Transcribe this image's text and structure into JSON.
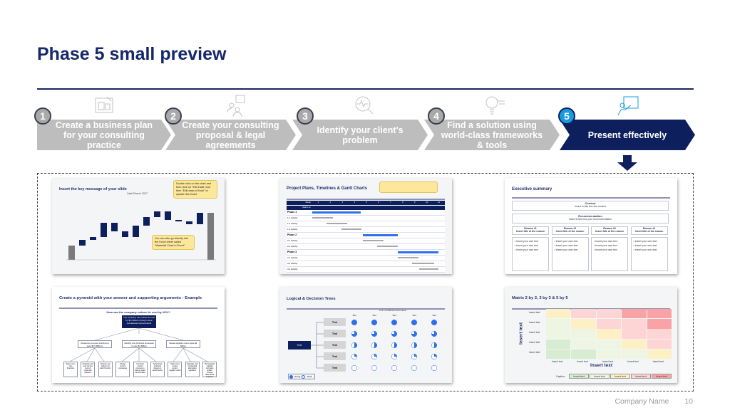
{
  "title": "Phase 5 small preview",
  "steps": [
    {
      "num": "1",
      "label": "Create a business plan for your consulting practice",
      "icon": "blueprint-icon"
    },
    {
      "num": "2",
      "label": "Create your consulting proposal & legal agreements",
      "icon": "people-question-icon"
    },
    {
      "num": "3",
      "label": "Identify your client's problem",
      "icon": "magnifier-pulse-icon"
    },
    {
      "num": "4",
      "label": "Find a solution using world-class frameworks & tools",
      "icon": "lightbulb-icon"
    },
    {
      "num": "5",
      "label": "Present effectively",
      "icon": "presenter-board-icon",
      "active": true
    }
  ],
  "colors": {
    "navy": "#0d1f5c",
    "accent": "#1a9be0",
    "inactive": "#bdbdbd",
    "gantt_phase": "#2f6fec",
    "bar": "#0d1f5c"
  },
  "previews": {
    "waterfall": {
      "title": "Insert the key message of your slide",
      "chart_title": "Cash Flow in 2017",
      "callout1": "Double click on the chart and then click on \"Edit Data\" and then \"Edit data in Excel\" to update this Chart",
      "callout2": "You can also go directly into the Excel sheet called \"Waterfall Chart in Excel\""
    },
    "gantt": {
      "title": "Project Plans, Timelines & Gantt Charts",
      "week_label": "Week",
      "starts_label": "Starts on",
      "weeks": [
        "1",
        "2",
        "3",
        "4",
        "5",
        "6",
        "7",
        "8",
        "9",
        "10",
        "11"
      ],
      "rows": [
        "Phase 1",
        "1.1 Activity",
        "1.2 Activity",
        "1.3 Activity",
        "Phase 2",
        "2.1 Activity",
        "2.2 Activity",
        "Phase 3",
        "3.1 Activity",
        "3.2 Activity",
        "3.3 Activity"
      ]
    },
    "exec": {
      "title": "Executive summary",
      "context": "Context",
      "context_text": "Insert in this box the context",
      "recommendation": "Recommendation",
      "recommendation_text": "Insert in this box your recommendation",
      "reasons": [
        "Reason #1",
        "Reason #2",
        "Reason #3",
        "Reason #4"
      ],
      "reason_sub": "Insert title of the reason",
      "bullet": "• Insert your own text"
    },
    "pyramid": {
      "title": "Create a pyramid with your answer and supporting arguments - Example",
      "question": "How can the company reduce its cost by 10%?",
      "top": "The company can reduce its cost by $3 millions through some operational improvements",
      "mid": [
        "Outsource non-core functions to save $0.5 Millions",
        "Simplify core functions processes to save $1 Million",
        "Renew supplier cost to save $1 Million"
      ],
      "leaves": [
        "Select non-core functions",
        "Evaluate cost and service level of potential partners",
        "Choose one partner for each function",
        "Design current processes",
        "Compare current process to best-in-class benchmarks",
        "Adopt best practices based on benchmarks",
        "Select and review current supplier costs",
        "Evaluate cost of potential alternative suppliers",
        "Renegotiate supplier contracts and/or choose alternative suppliers"
      ]
    },
    "trees": {
      "title": "Logical & Decision Trees",
      "unit": "Unit or additional information",
      "root": "Text",
      "node": "Text",
      "col": "Text",
      "legend_strong": "strong",
      "legend_weak": "weak"
    },
    "matrix": {
      "title": "Matrix 2 by 2, 3 by 3 & 5 by 5",
      "axis": "Insert text",
      "cell": "Insert text",
      "caption": "Caption:"
    }
  },
  "footer": {
    "company": "Company Name",
    "page": "10"
  }
}
